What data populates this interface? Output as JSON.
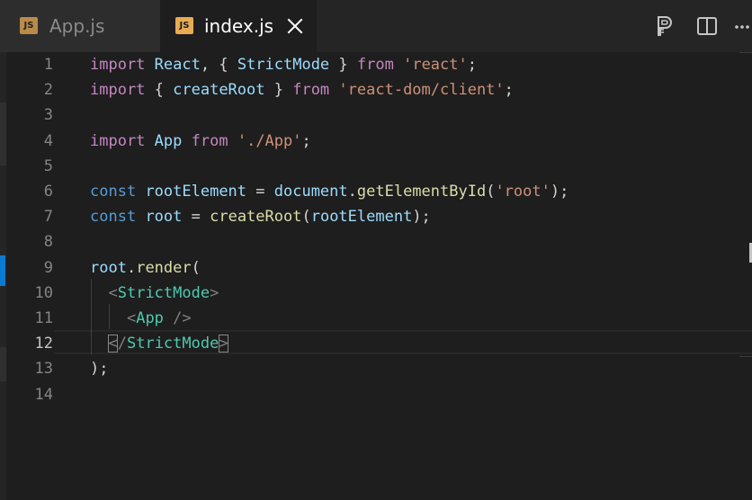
{
  "tabs": [
    {
      "label": "App.js",
      "icon": "js-file-icon",
      "icon_text": "JS",
      "active": false
    },
    {
      "label": "index.js",
      "icon": "js-file-icon",
      "icon_text": "JS",
      "active": true
    }
  ],
  "tab_actions": [
    {
      "name": "open-preview-icon"
    },
    {
      "name": "split-editor-icon"
    },
    {
      "name": "more-actions-icon"
    }
  ],
  "editor": {
    "active_line": 12,
    "line_numbers": [
      "1",
      "2",
      "3",
      "4",
      "5",
      "6",
      "7",
      "8",
      "9",
      "10",
      "11",
      "12",
      "13",
      "14"
    ],
    "lines": [
      [
        {
          "t": "import",
          "c": "ctl"
        },
        {
          "t": " ",
          "c": "pun"
        },
        {
          "t": "React",
          "c": "var"
        },
        {
          "t": ", { ",
          "c": "pun"
        },
        {
          "t": "StrictMode",
          "c": "var"
        },
        {
          "t": " } ",
          "c": "pun"
        },
        {
          "t": "from",
          "c": "ctl"
        },
        {
          "t": " ",
          "c": "pun"
        },
        {
          "t": "'react'",
          "c": "str"
        },
        {
          "t": ";",
          "c": "pun"
        }
      ],
      [
        {
          "t": "import",
          "c": "ctl"
        },
        {
          "t": " { ",
          "c": "pun"
        },
        {
          "t": "createRoot",
          "c": "var"
        },
        {
          "t": " } ",
          "c": "pun"
        },
        {
          "t": "from",
          "c": "ctl"
        },
        {
          "t": " ",
          "c": "pun"
        },
        {
          "t": "'react-dom/client'",
          "c": "str"
        },
        {
          "t": ";",
          "c": "pun"
        }
      ],
      [],
      [
        {
          "t": "import",
          "c": "ctl"
        },
        {
          "t": " ",
          "c": "pun"
        },
        {
          "t": "App",
          "c": "var"
        },
        {
          "t": " ",
          "c": "pun"
        },
        {
          "t": "from",
          "c": "ctl"
        },
        {
          "t": " ",
          "c": "pun"
        },
        {
          "t": "'./App'",
          "c": "str"
        },
        {
          "t": ";",
          "c": "pun"
        }
      ],
      [],
      [
        {
          "t": "const",
          "c": "kw"
        },
        {
          "t": " ",
          "c": "pun"
        },
        {
          "t": "rootElement",
          "c": "var"
        },
        {
          "t": " = ",
          "c": "pun"
        },
        {
          "t": "document",
          "c": "var"
        },
        {
          "t": ".",
          "c": "pun"
        },
        {
          "t": "getElementById",
          "c": "fn"
        },
        {
          "t": "(",
          "c": "pun"
        },
        {
          "t": "'root'",
          "c": "str"
        },
        {
          "t": ");",
          "c": "pun"
        }
      ],
      [
        {
          "t": "const",
          "c": "kw"
        },
        {
          "t": " ",
          "c": "pun"
        },
        {
          "t": "root",
          "c": "var"
        },
        {
          "t": " = ",
          "c": "pun"
        },
        {
          "t": "createRoot",
          "c": "fn"
        },
        {
          "t": "(",
          "c": "pun"
        },
        {
          "t": "rootElement",
          "c": "var"
        },
        {
          "t": ");",
          "c": "pun"
        }
      ],
      [],
      [
        {
          "t": "root",
          "c": "var"
        },
        {
          "t": ".",
          "c": "pun"
        },
        {
          "t": "render",
          "c": "fn"
        },
        {
          "t": "(",
          "c": "pun"
        }
      ],
      [
        {
          "t": "  ",
          "c": "pun"
        },
        {
          "t": "<",
          "c": "ang"
        },
        {
          "t": "StrictMode",
          "c": "tag"
        },
        {
          "t": ">",
          "c": "ang"
        }
      ],
      [
        {
          "t": "    ",
          "c": "pun"
        },
        {
          "t": "<",
          "c": "ang"
        },
        {
          "t": "App",
          "c": "tag"
        },
        {
          "t": " />",
          "c": "ang"
        }
      ],
      [
        {
          "t": "  ",
          "c": "pun"
        },
        {
          "t": "<",
          "c": "ang",
          "box": true
        },
        {
          "t": "/",
          "c": "ang"
        },
        {
          "t": "StrictMode",
          "c": "tag"
        },
        {
          "t": ">",
          "c": "ang",
          "box": true
        }
      ],
      [
        {
          "t": ");",
          "c": "pun"
        }
      ],
      []
    ]
  },
  "colors": {
    "editor_background": "#1e1e1e",
    "tab_bar_background": "#252526",
    "inactive_tab_background": "#2d2d2d",
    "active_line_accent": "#0b7ad1",
    "js_icon": "#e8ab53"
  }
}
